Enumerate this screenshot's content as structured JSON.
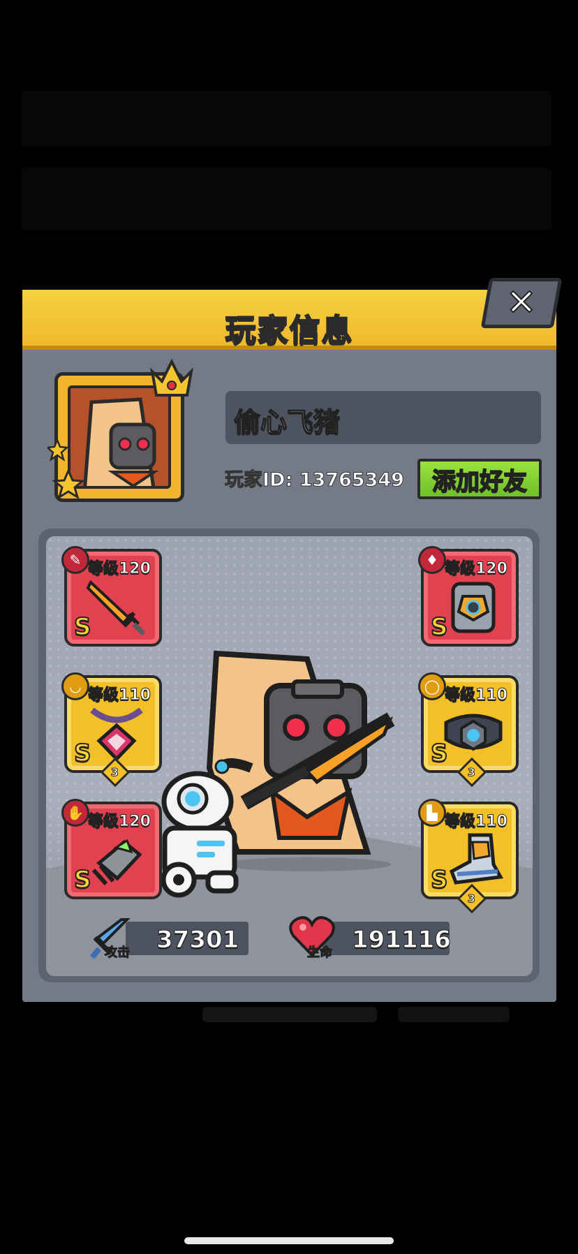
{
  "dialog": {
    "title": "玩家信息",
    "close_symbol": "✕"
  },
  "player": {
    "name": "偷心飞猪",
    "id_text": "玩家ID: 13765349",
    "add_friend_label": "添加好友",
    "avatar_icon": "hooded-robot-avatar-icon"
  },
  "equipment": {
    "left": [
      {
        "type_icon": "weapon-icon",
        "level": "等级120",
        "grade": "S",
        "stars": "",
        "frame": "red",
        "art_icon": "flame-sword-icon"
      },
      {
        "type_icon": "necklace-icon",
        "level": "等级110",
        "grade": "S",
        "stars": "3",
        "frame": "gold",
        "art_icon": "chain-amulet-icon"
      },
      {
        "type_icon": "glove-icon",
        "level": "等级120",
        "grade": "S",
        "stars": "",
        "frame": "red",
        "art_icon": "mech-gauntlet-icon"
      }
    ],
    "right": [
      {
        "type_icon": "armor-icon",
        "level": "等级120",
        "grade": "S",
        "stars": "",
        "frame": "red",
        "art_icon": "mech-armor-icon"
      },
      {
        "type_icon": "belt-icon",
        "level": "等级110",
        "grade": "S",
        "stars": "3",
        "frame": "gold",
        "art_icon": "hex-belt-icon"
      },
      {
        "type_icon": "boots-icon",
        "level": "等级110",
        "grade": "S",
        "stars": "3",
        "frame": "gold",
        "art_icon": "mech-boots-icon"
      }
    ]
  },
  "stats": {
    "attack_label": "攻击",
    "attack_value": "37301",
    "hp_label": "生命",
    "hp_value": "191116"
  },
  "colors": {
    "header_yellow": "#f3c63a",
    "panel_gray": "#747a86",
    "button_green": "#7fcf31",
    "slot_red": "#e2424f",
    "slot_gold": "#f4c028"
  }
}
